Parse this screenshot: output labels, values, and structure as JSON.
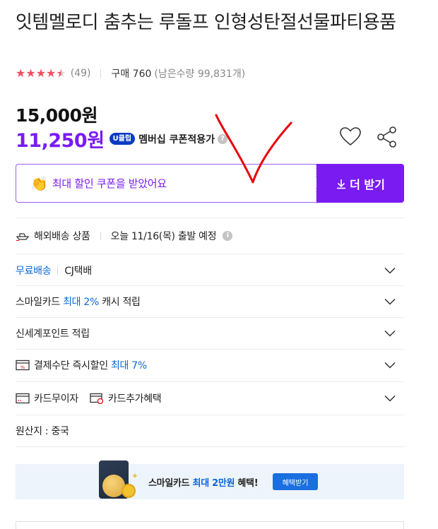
{
  "product": {
    "title": "잇템멜로디 춤추는 루돌프 인형성탄절선물파티용품",
    "rating": {
      "stars": 4.5,
      "review_count": "(49)"
    },
    "purchase": "구매 760",
    "remaining": "(남은수량 99,831개)"
  },
  "price": {
    "original": "15,000원",
    "sale": "11,250원",
    "uclub_badge": "U클럽",
    "member_text": "멤버십 쿠폰적용가"
  },
  "coupon": {
    "text": "최대 할인 쿠폰을 받았어요",
    "button_label": "더 받기"
  },
  "shipping": {
    "overseas_label": "해외배송 상품",
    "departure": "오늘 11/16(목) 출발 예정"
  },
  "rows": {
    "free_shipping": "무료배송",
    "courier": "CJ택배",
    "smilecard_prefix": "스마일카드 ",
    "smilecard_highlight": "최대 2%",
    "smilecard_suffix": " 캐시 적립",
    "shinsegae": "신세계포인트 적립",
    "payment_prefix": "결제수단 즉시할인 ",
    "payment_highlight": "최대 7%",
    "installment": "카드무이자",
    "card_benefit": "카드추가혜택",
    "origin": "원산지 : 중국"
  },
  "banner": {
    "text_prefix": "스마일카드 ",
    "text_highlight": "최대 2만원",
    "text_suffix": " 혜택!",
    "button_label": "혜택받기"
  },
  "colors": {
    "accent_purple": "#7a1bf2",
    "link_blue": "#0a66d6",
    "star_red": "#f0505f",
    "scribble_red": "#e8000b"
  },
  "icons": {
    "heart": "heart-icon",
    "share": "share-icon",
    "clap": "clapping-hands-icon",
    "download": "download-icon",
    "chevron": "chevron-down-icon",
    "ship": "ship-icon",
    "info": "info-icon",
    "payment": "payment-discount-icon",
    "card": "card-icon",
    "card_gift": "card-gift-icon"
  }
}
